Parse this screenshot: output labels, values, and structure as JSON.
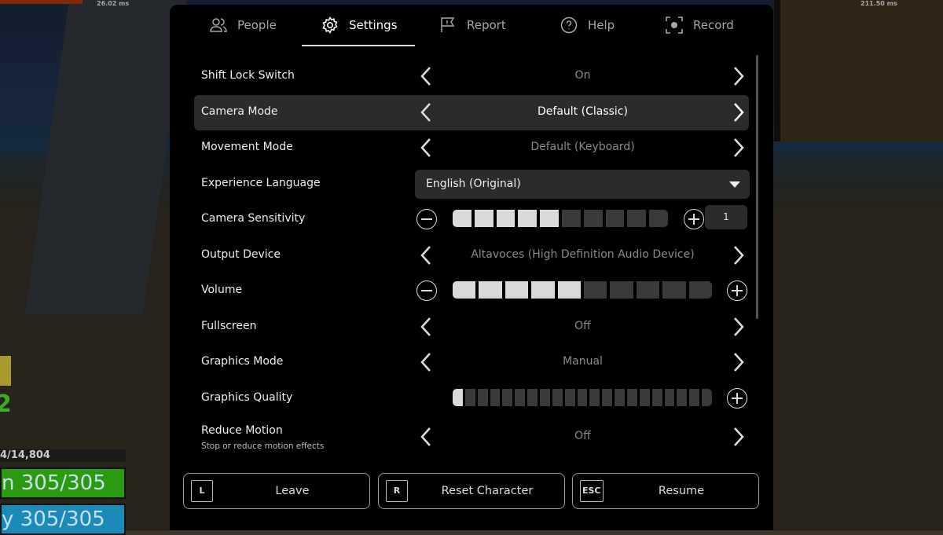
{
  "background": {
    "stats": [
      "26.02 ms",
      "211.50 ms"
    ],
    "hud": {
      "level_fragment": "2",
      "xp": "4/14,804",
      "health": "n 305/305",
      "energy": "y 305/305"
    }
  },
  "tabs": [
    {
      "label": "People",
      "icon": "people-icon"
    },
    {
      "label": "Settings",
      "icon": "gear-icon",
      "active": true
    },
    {
      "label": "Report",
      "icon": "flag-icon"
    },
    {
      "label": "Help",
      "icon": "help-icon"
    },
    {
      "label": "Record",
      "icon": "record-icon"
    }
  ],
  "settings": {
    "shift_lock": {
      "label": "Shift Lock Switch",
      "value": "On"
    },
    "camera_mode": {
      "label": "Camera Mode",
      "value": "Default (Classic)"
    },
    "movement_mode": {
      "label": "Movement Mode",
      "value": "Default (Keyboard)"
    },
    "language": {
      "label": "Experience Language",
      "value": "English (Original)"
    },
    "camera_sensitivity": {
      "label": "Camera Sensitivity",
      "level": 5,
      "segments": 10,
      "value": "1"
    },
    "output_device": {
      "label": "Output Device",
      "value": "Altavoces (High Definition Audio Device)"
    },
    "volume": {
      "label": "Volume",
      "level": 5,
      "segments": 10
    },
    "fullscreen": {
      "label": "Fullscreen",
      "value": "Off"
    },
    "graphics_mode": {
      "label": "Graphics Mode",
      "value": "Manual"
    },
    "graphics_quality": {
      "label": "Graphics Quality",
      "level": 1,
      "segments": 21
    },
    "reduce_motion": {
      "label": "Reduce Motion",
      "description": "Stop or reduce motion effects",
      "value": "Off"
    }
  },
  "buttons": {
    "leave": {
      "key": "L",
      "label": "Leave"
    },
    "reset": {
      "key": "R",
      "label": "Reset Character"
    },
    "resume": {
      "key": "ESC",
      "label": "Resume"
    }
  },
  "colors": {
    "panel": "#000000",
    "highlight": "#2b2b2d",
    "segment_on": "#d9d9d9",
    "segment_off": "#3a3a3a",
    "health": "#2a9a10",
    "energy": "#1a8ab8"
  }
}
